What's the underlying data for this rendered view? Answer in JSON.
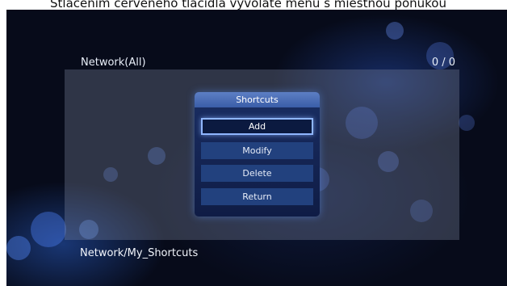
{
  "caption": "Stlačením červeného tlačidla vyvoláte menu s miestnou ponukou",
  "header": {
    "title": "Network(All)",
    "counter": "0 / 0"
  },
  "popup": {
    "title": "Shortcuts",
    "items": [
      {
        "label": "Add",
        "selected": true
      },
      {
        "label": "Modify",
        "selected": false
      },
      {
        "label": "Delete",
        "selected": false
      },
      {
        "label": "Return",
        "selected": false
      }
    ]
  },
  "footer": {
    "path": "Network/My_Shortcuts"
  },
  "colors": {
    "accent": "#8fb6ff",
    "background": "#070b1a",
    "menu": "#22417e"
  }
}
